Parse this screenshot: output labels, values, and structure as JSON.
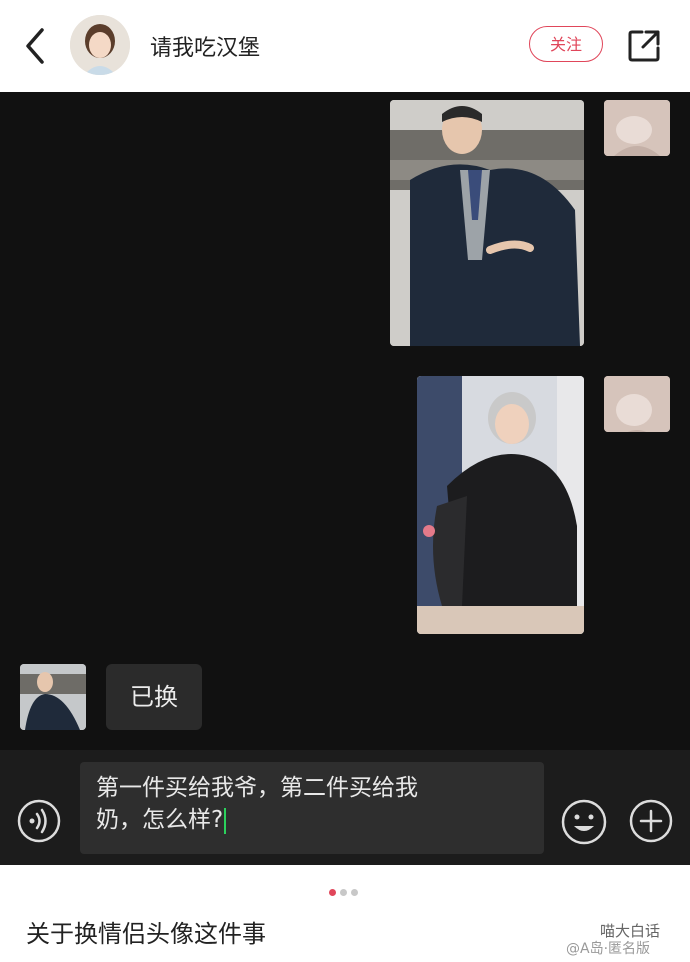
{
  "header": {
    "title": "请我吃汉堡",
    "follow_label": "关注"
  },
  "chat": {
    "friend_message": "已换",
    "images": [
      "jacket-man-photo",
      "jacket-grandma-photo"
    ]
  },
  "input": {
    "line1": "第一件买给我爷，第二件买给我",
    "line2": "奶，怎么样?"
  },
  "pager": {
    "count": 3,
    "active": 0
  },
  "caption": "关于换情侣头像这件事",
  "watermark": {
    "brand": "喵大白话",
    "handle": "@A岛·匿名版"
  },
  "colors": {
    "accent": "#e0465a",
    "chat_bg": "#111111",
    "cursor": "#2bd15c"
  }
}
